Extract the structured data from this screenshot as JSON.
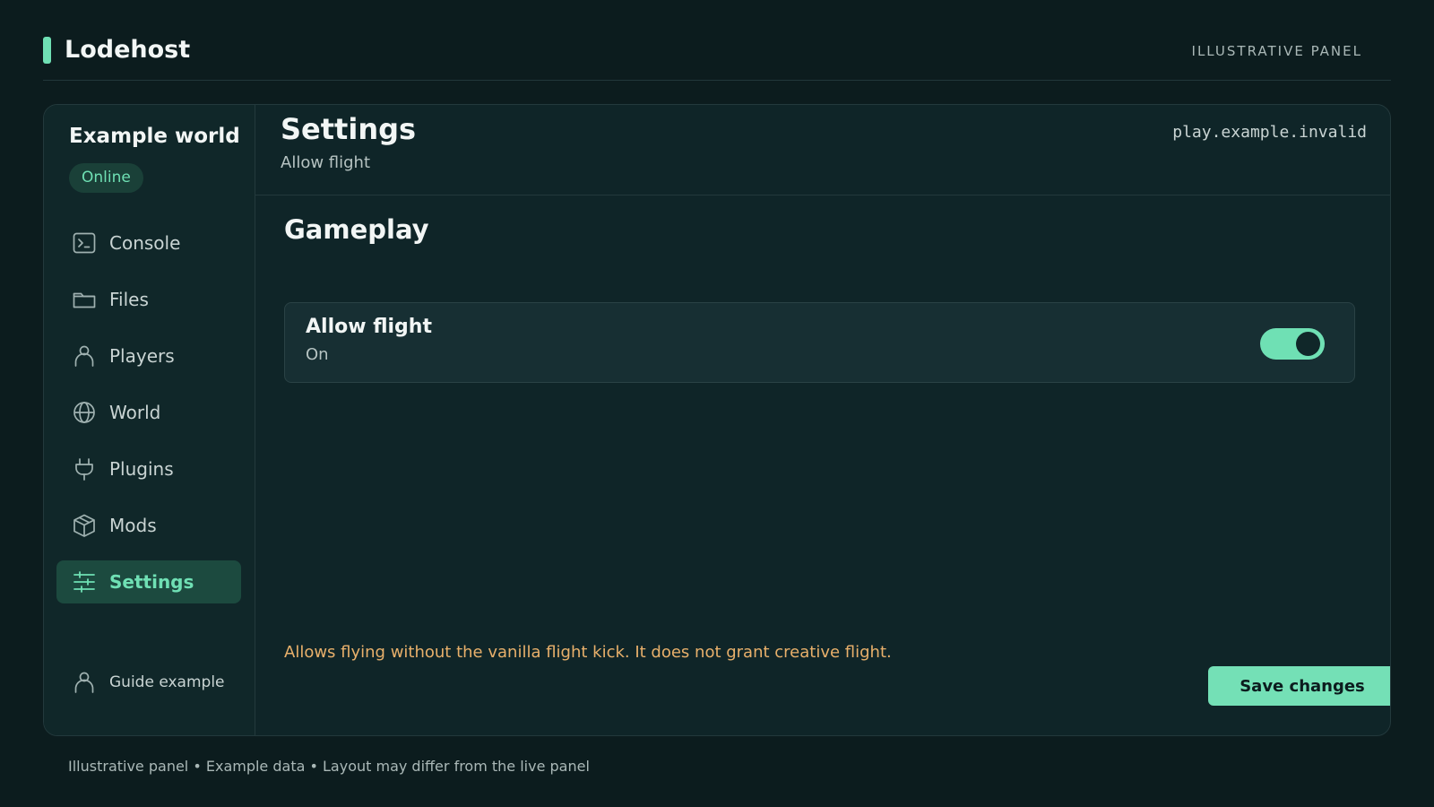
{
  "app": {
    "name": "Lodehost",
    "tag": "ILLUSTRATIVE PANEL"
  },
  "server": {
    "name": "Example world",
    "status": "Online",
    "address": "play.example.invalid"
  },
  "sidebar": {
    "items": [
      {
        "label": "Console",
        "icon": "terminal-icon"
      },
      {
        "label": "Files",
        "icon": "folder-icon"
      },
      {
        "label": "Players",
        "icon": "person-icon"
      },
      {
        "label": "World",
        "icon": "globe-icon"
      },
      {
        "label": "Plugins",
        "icon": "plug-icon"
      },
      {
        "label": "Mods",
        "icon": "cube-icon"
      },
      {
        "label": "Settings",
        "icon": "sliders-icon",
        "active": true
      }
    ],
    "user": "Guide example"
  },
  "page": {
    "title": "Settings",
    "subtitle": "Allow flight",
    "section": "Gameplay"
  },
  "setting": {
    "name": "Allow flight",
    "value": "On",
    "enabled": true
  },
  "hint": "Allows flying without the vanilla flight kick. It does not grant creative flight.",
  "actions": {
    "save_label": "Save changes"
  },
  "footer": "Illustrative panel • Example data • Layout may differ from the live panel",
  "colors": {
    "accent": "#6fe0b4",
    "background": "#0c1c1e",
    "panel": "#0f2528",
    "warning": "#e8b06b"
  }
}
